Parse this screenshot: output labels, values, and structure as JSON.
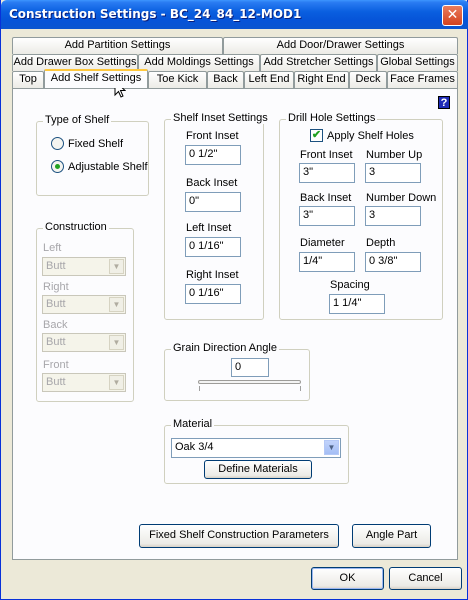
{
  "window": {
    "title": "Construction Settings - BC_24_84_12-MOD1",
    "close": "✕"
  },
  "tabs": {
    "row1": [
      "Add Partition Settings",
      "Add Door/Drawer Settings"
    ],
    "row2": [
      "Add Drawer Box Settings",
      "Add Moldings Settings",
      "Add Stretcher Settings",
      "Global Settings"
    ],
    "row3": [
      "Top",
      "Add Shelf Settings",
      "Toe Kick",
      "Back",
      "Left End",
      "Right End",
      "Deck",
      "Face Frames"
    ],
    "active": "Add Shelf Settings"
  },
  "help": "?",
  "type_of_shelf": {
    "label": "Type of Shelf",
    "options": [
      "Fixed Shelf",
      "Adjustable Shelf"
    ],
    "selected": "Adjustable Shelf"
  },
  "construction": {
    "label": "Construction",
    "fields": [
      {
        "label": "Left",
        "value": "Butt"
      },
      {
        "label": "Right",
        "value": "Butt"
      },
      {
        "label": "Back",
        "value": "Butt"
      },
      {
        "label": "Front",
        "value": "Butt"
      }
    ]
  },
  "shelf_inset": {
    "label": "Shelf Inset Settings",
    "front_label": "Front Inset",
    "front_value": "0 1/2\"",
    "back_label": "Back Inset",
    "back_value": "0\"",
    "left_label": "Left Inset",
    "left_value": "0 1/16\"",
    "right_label": "Right Inset",
    "right_value": "0 1/16\""
  },
  "drill_hole": {
    "label": "Drill Hole Settings",
    "apply_label": "Apply Shelf Holes",
    "apply_checked": true,
    "front_inset_label": "Front Inset",
    "front_inset_value": "3\"",
    "number_up_label": "Number Up",
    "number_up_value": "3",
    "back_inset_label": "Back Inset",
    "back_inset_value": "3\"",
    "number_down_label": "Number Down",
    "number_down_value": "3",
    "diameter_label": "Diameter",
    "diameter_value": "1/4\"",
    "depth_label": "Depth",
    "depth_value": "0 3/8\"",
    "spacing_label": "Spacing",
    "spacing_value": "1 1/4\""
  },
  "grain": {
    "label": "Grain Direction Angle",
    "value": "0",
    "slider_position": 0
  },
  "material": {
    "label": "Material",
    "value": "Oak 3/4",
    "define_button": "Define Materials"
  },
  "buttons": {
    "fixed_shelf_params": "Fixed Shelf Construction Parameters",
    "angle_part": "Angle Part",
    "ok": "OK",
    "cancel": "Cancel"
  },
  "colors": {
    "title_bar": "#0a5fe0",
    "active_tab_accent": "#ffc83c",
    "window_bg": "#ece9d8"
  }
}
